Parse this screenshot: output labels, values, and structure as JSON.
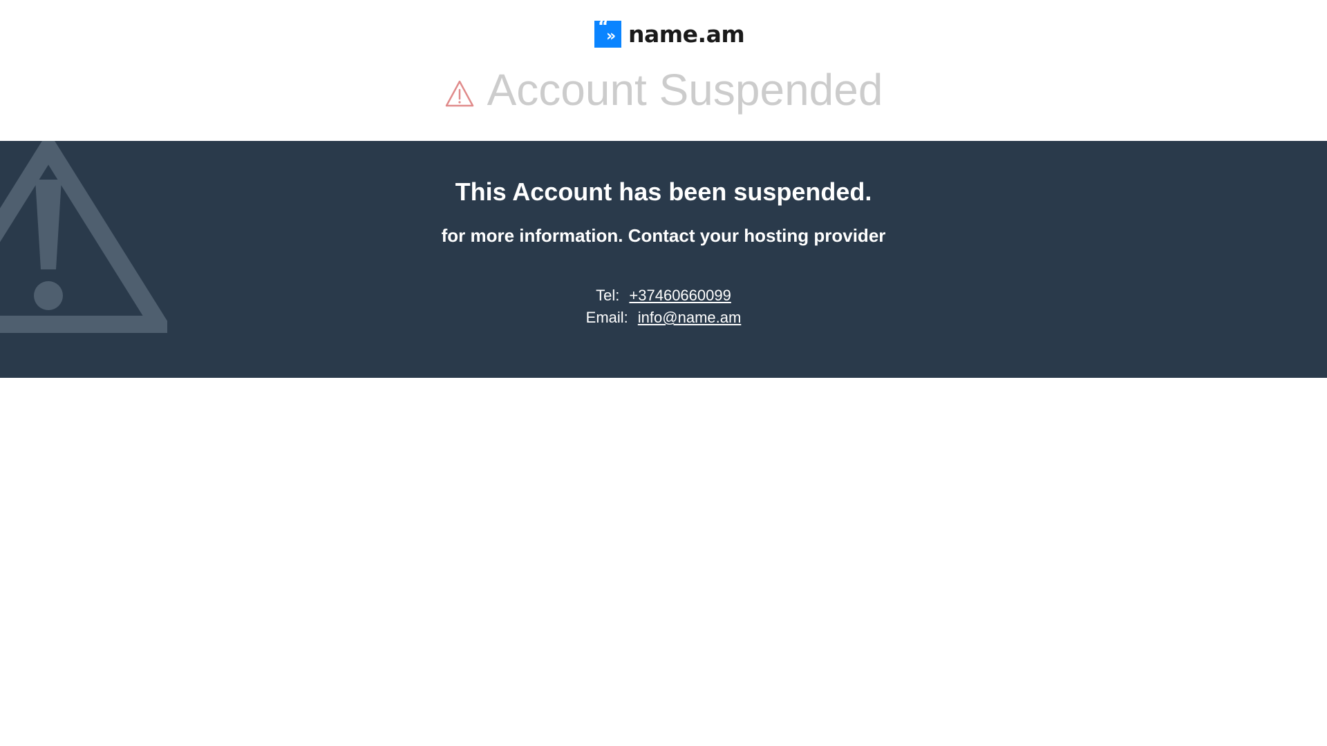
{
  "brand": {
    "logo_text": "name.am",
    "logo_color": "#0a84ff"
  },
  "page": {
    "title": "Account Suspended",
    "warning_icon_color": "#e08a8a"
  },
  "banner": {
    "background": "#2a3a4b",
    "headline": "This Account has been suspended.",
    "subline": "for more information. Contact your hosting provider",
    "contacts": {
      "tel_label": "Tel:",
      "tel_value": "+37460660099",
      "email_label": "Email:",
      "email_value": "info@name.am"
    }
  }
}
